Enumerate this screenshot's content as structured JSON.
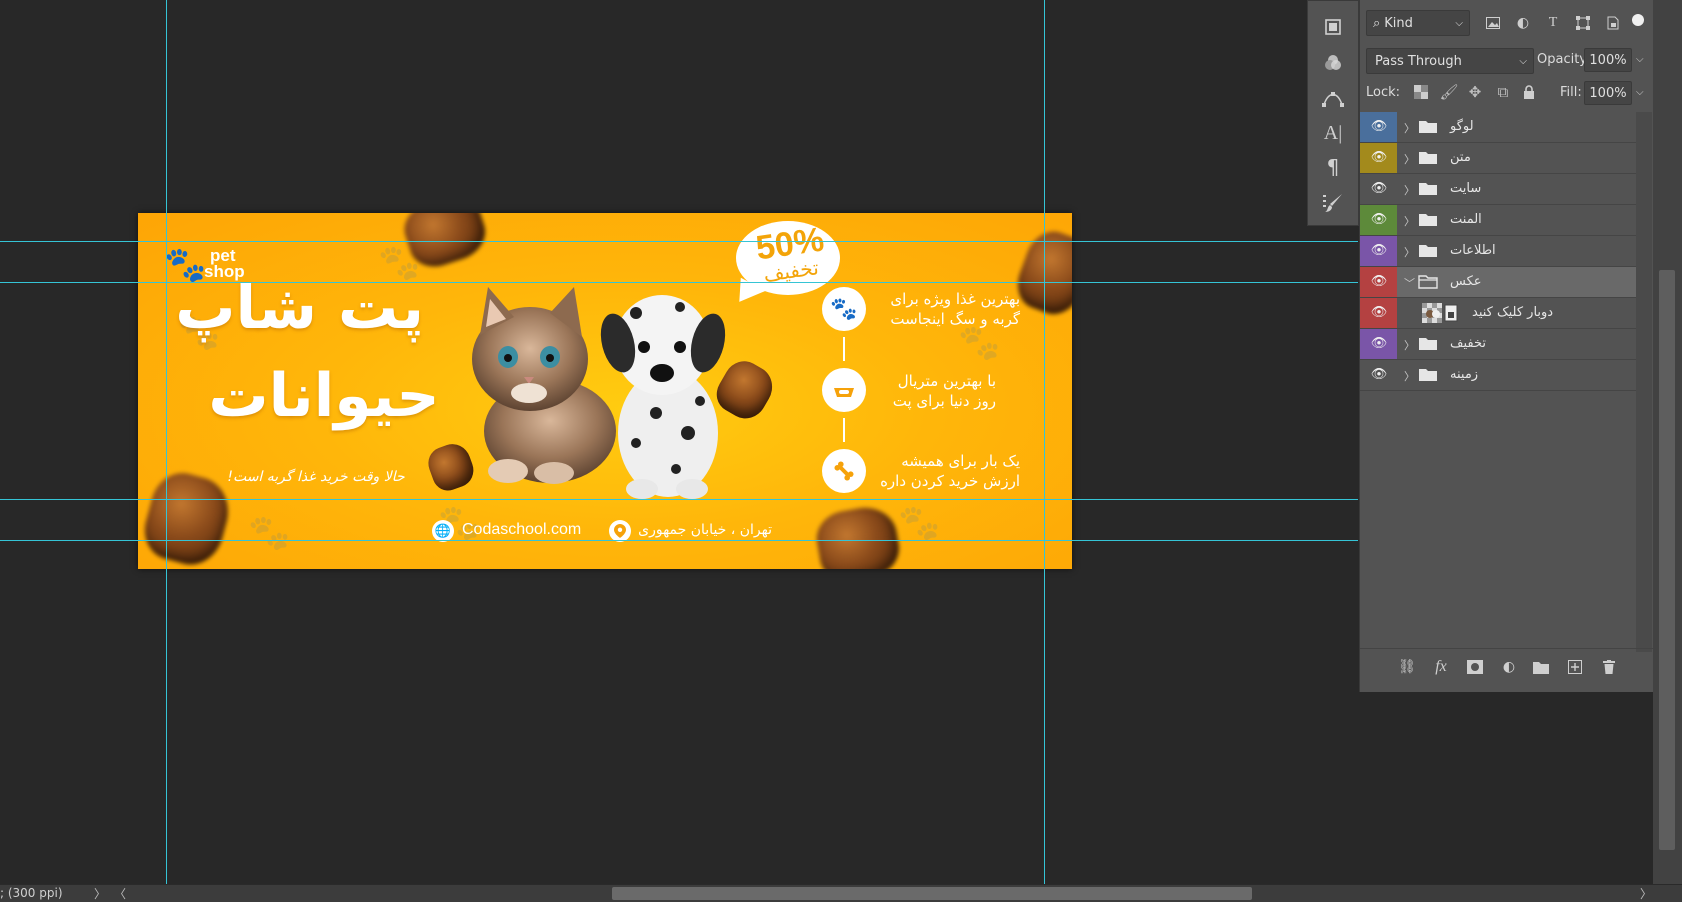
{
  "banner": {
    "logo_line1": "pet",
    "logo_line2": "shop",
    "title_line1": "پت شاپ",
    "title_line2": "حیوانات",
    "subtitle": "حالا وقت خرید غذا گربه است!",
    "discount_percent": "50%",
    "discount_label": "تخفیف",
    "features": [
      {
        "line1": "بهترین غذا ویژه برای",
        "line2": "گربه و سگ اینجاست",
        "icon": "paw-icon"
      },
      {
        "line1": "با بهترین متریال",
        "line2": "روز دنیا برای پت",
        "icon": "pet-bowl-icon"
      },
      {
        "line1": "یک بار برای همیشه",
        "line2": "ارزش خرید کردن داره",
        "icon": "bone-icon"
      }
    ],
    "website": "Codaschool.com",
    "address": "تهران ، خیابان جمهوری",
    "bg_color": "#ffb60a"
  },
  "layers_panel": {
    "filter_kind": "Kind",
    "blend_mode": "Pass Through",
    "opacity_label": "Opacity:",
    "opacity_value": "100%",
    "lock_label": "Lock:",
    "fill_label": "Fill:",
    "fill_value": "100%",
    "layers": [
      {
        "name": "لوگو",
        "color": "#4a6f9c",
        "type": "group",
        "expanded": false
      },
      {
        "name": "متن",
        "color": "#a38a1c",
        "type": "group",
        "expanded": false
      },
      {
        "name": "سایت",
        "color": "#535353",
        "type": "group",
        "expanded": false
      },
      {
        "name": "المنت",
        "color": "#5d8a3a",
        "type": "group",
        "expanded": false
      },
      {
        "name": "اطلاعات",
        "color": "#7a55a8",
        "type": "group",
        "expanded": false
      },
      {
        "name": "عکس",
        "color": "#b44141",
        "type": "group",
        "expanded": true,
        "selected": true
      },
      {
        "name": "دوبار کلیک کنید",
        "color": "#b44141",
        "type": "smart-object",
        "child": true
      },
      {
        "name": "تخفیف",
        "color": "#7a55a8",
        "type": "group",
        "expanded": false
      },
      {
        "name": "زمینه",
        "color": "#535353",
        "type": "group",
        "expanded": false
      }
    ]
  },
  "status": {
    "zoom_text": "; (300 ppi)"
  },
  "colors": {
    "guide": "#35c4d6",
    "workspace": "#282828",
    "panel": "#535353",
    "accent": "#f6a20a"
  }
}
